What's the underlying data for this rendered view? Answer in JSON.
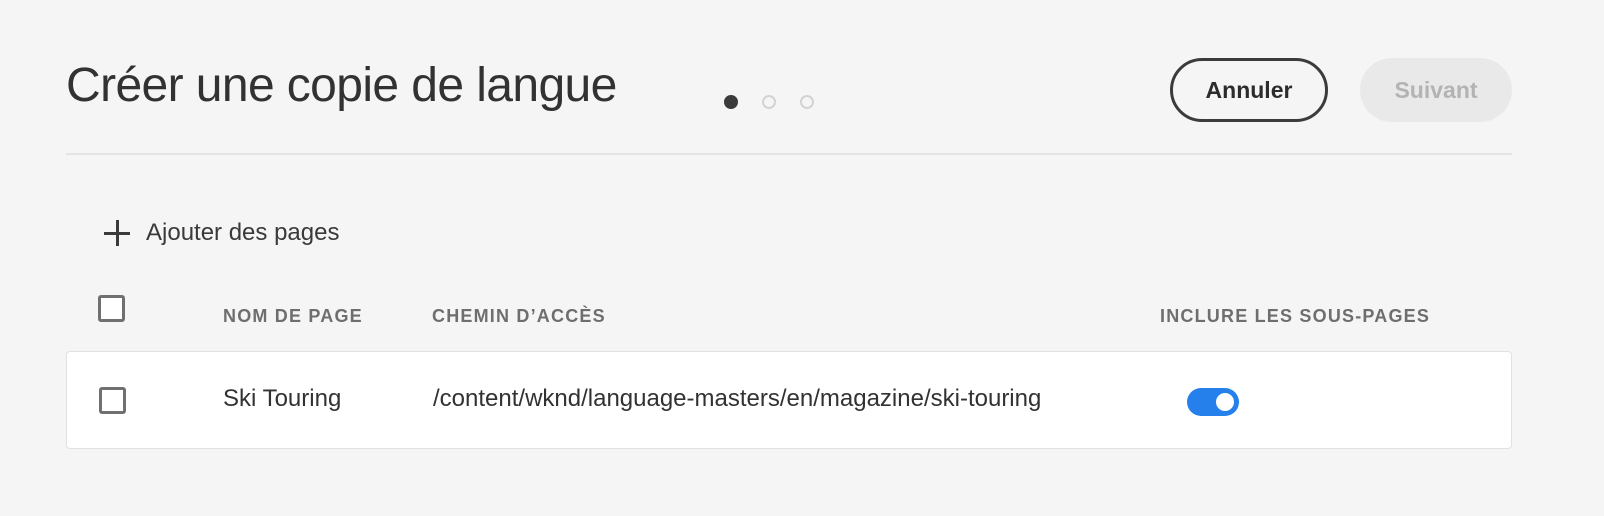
{
  "header": {
    "title": "Créer une copie de langue",
    "steps": {
      "total": 3,
      "current": 1
    },
    "cancel_label": "Annuler",
    "next_label": "Suivant"
  },
  "toolbar": {
    "add_pages_label": "Ajouter des pages"
  },
  "table": {
    "columns": {
      "name": "NOM DE PAGE",
      "path": "CHEMIN D’ACCÈS",
      "include_subpages": "INCLURE LES SOUS-PAGES"
    },
    "rows": [
      {
        "name": "Ski Touring",
        "path": "/content/wknd/language-masters/en/magazine/ski-touring",
        "include_subpages": true,
        "selected": false
      }
    ]
  },
  "colors": {
    "accent": "#2680eb",
    "background": "#f5f5f5"
  }
}
